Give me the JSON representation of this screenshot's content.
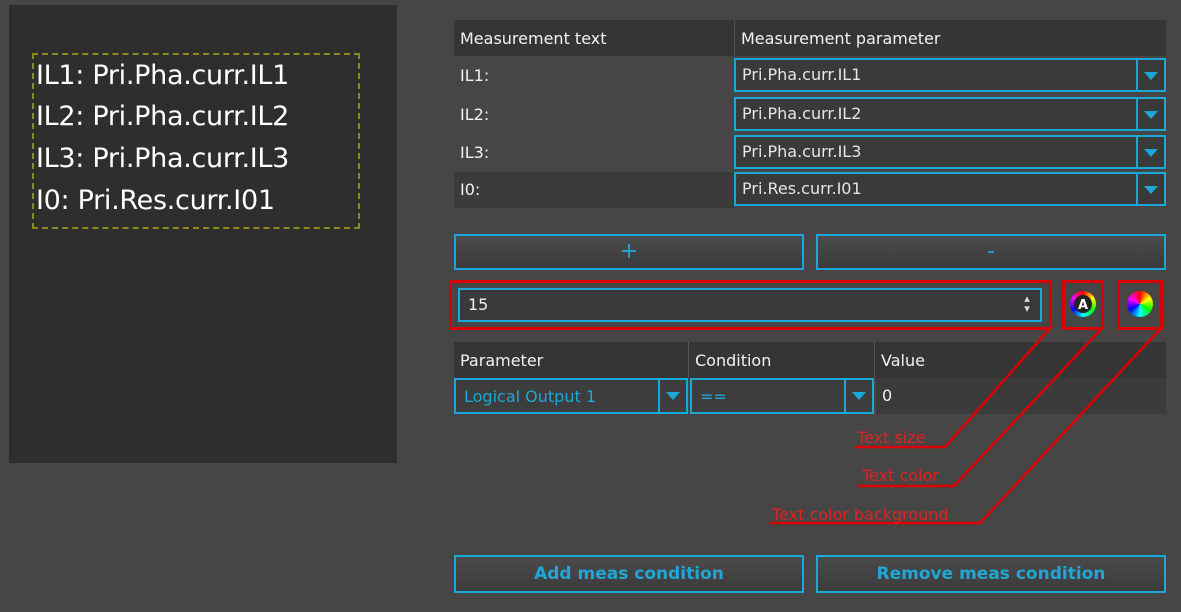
{
  "preview": {
    "lines": [
      "IL1: Pri.Pha.curr.IL1",
      "IL2: Pri.Pha.curr.IL2",
      "IL3: Pri.Pha.curr.IL3",
      "I0: Pri.Res.curr.I01"
    ]
  },
  "meas_table": {
    "headers": [
      "Measurement text",
      "Measurement parameter"
    ],
    "rows": [
      {
        "text": "IL1:",
        "param": "Pri.Pha.curr.IL1"
      },
      {
        "text": "IL2:",
        "param": "Pri.Pha.curr.IL2"
      },
      {
        "text": "IL3:",
        "param": "Pri.Pha.curr.IL3"
      },
      {
        "text": "I0:",
        "param": "Pri.Res.curr.I01"
      }
    ]
  },
  "buttons": {
    "add": "+",
    "remove": "-",
    "add_condition": "Add meas condition",
    "remove_condition": "Remove meas condition"
  },
  "text_size": {
    "value": "15"
  },
  "cond_table": {
    "headers": [
      "Parameter",
      "Condition",
      "Value"
    ],
    "parameter": "Logical Output 1",
    "condition": "==",
    "value": "0"
  },
  "annotations": {
    "text_size": "Text size",
    "text_color": "Text color",
    "text_color_background": "Text color background"
  },
  "colors": {
    "accent": "#1aa8d8",
    "annotation": "#dd0000",
    "panel_bg": "#2e2e2e",
    "window_bg": "#464646"
  },
  "icons": [
    "text-color-icon",
    "color-wheel-icon",
    "dropdown-arrow-icon",
    "spin-updown-icon"
  ]
}
